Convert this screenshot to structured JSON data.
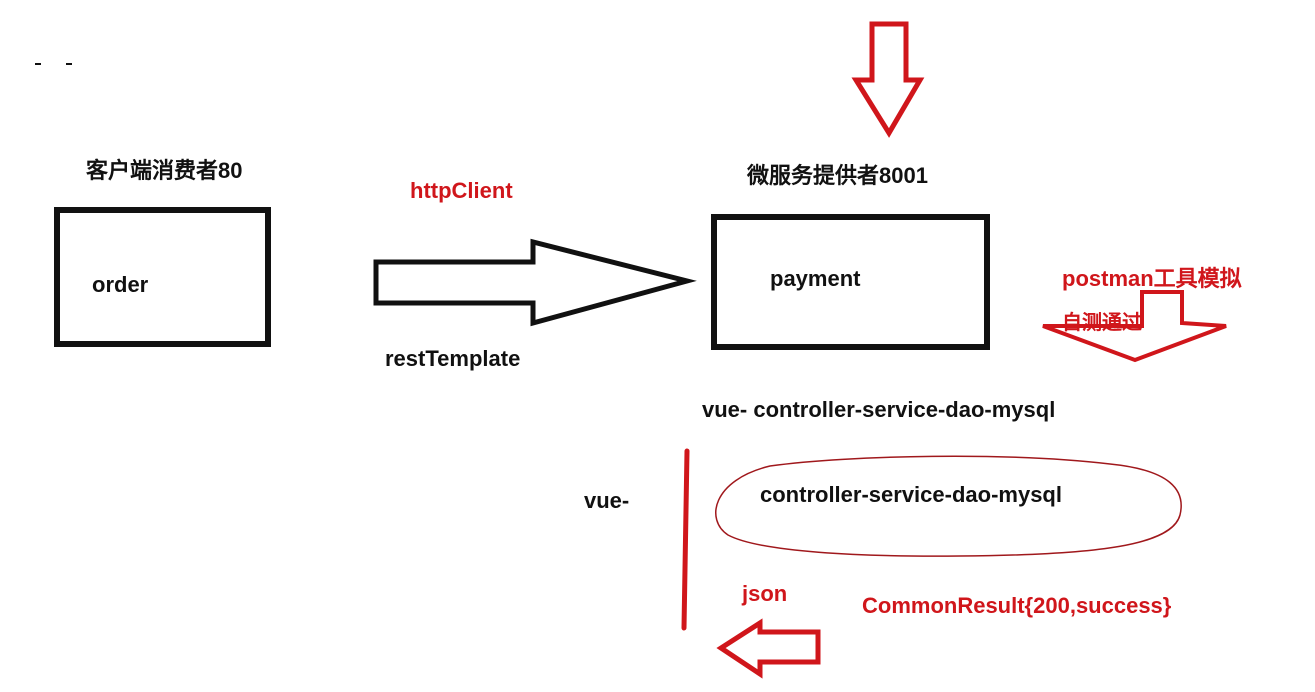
{
  "labels": {
    "consumer_title": "客户端消费者80",
    "order": "order",
    "http_client": "httpClient",
    "rest_template": "restTemplate",
    "provider_title": "微服务提供者8001",
    "payment": "payment",
    "postman_line1": "postman工具模拟",
    "postman_line2": "自测通过",
    "stack_full": "vue- controller-service-dao-mysql",
    "vue": "vue-",
    "stack_backend": "controller-service-dao-mysql",
    "json": "json",
    "common_result": "CommonResult{200,success}"
  },
  "colors": {
    "ink": "#111111",
    "red": "#d0161b",
    "background": "#ffffff"
  }
}
